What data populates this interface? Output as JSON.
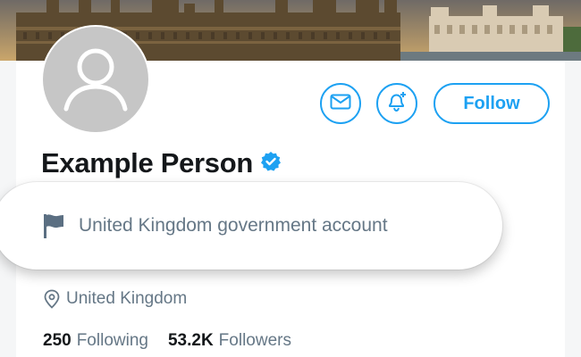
{
  "profile": {
    "name": "Example Person",
    "verified": true,
    "label": "United Kingdom government account",
    "location": "United Kingdom"
  },
  "actions": {
    "follow_label": "Follow",
    "message_icon": "envelope-icon",
    "notify_icon": "bell-plus-icon"
  },
  "stats": {
    "following_count": "250",
    "following_label": "Following",
    "followers_count": "53.2K",
    "followers_label": "Followers"
  },
  "colors": {
    "accent": "#1da1f2",
    "text_primary": "#14171a",
    "text_secondary": "#657786",
    "label_flag": "#5b6f82"
  }
}
